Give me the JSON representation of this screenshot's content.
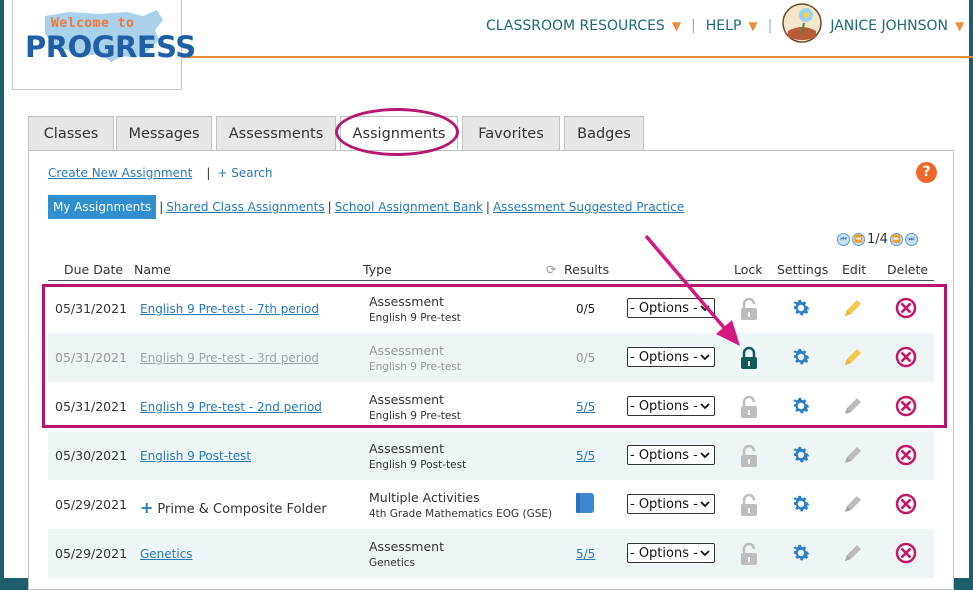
{
  "brand": {
    "logo_top": "Welcome to",
    "logo_main": "PROGRESS",
    "accent": "#f08a3c",
    "primary": "#1f6a76",
    "highlight": "#b5176f"
  },
  "topnav": {
    "resources": "CLASSROOM RESOURCES",
    "help": "HELP",
    "user": "JANICE JOHNSON"
  },
  "tabs": [
    "Classes",
    "Messages",
    "Assessments",
    "Assignments",
    "Favorites",
    "Badges"
  ],
  "active_tab": "Assignments",
  "actions": {
    "create": "Create New Assignment",
    "search": "+ Search"
  },
  "filters": [
    "My Assignments",
    "Shared Class Assignments",
    "School Assignment Bank",
    "Assessment Suggested Practice"
  ],
  "pager": {
    "page": "1/4"
  },
  "columns": {
    "due": "Due Date",
    "name": "Name",
    "type": "Type",
    "results": "Results",
    "lock": "Lock",
    "settings": "Settings",
    "edit": "Edit",
    "delete": "Delete"
  },
  "options_label": "- Options -",
  "rows": [
    {
      "due": "05/31/2021",
      "name": "English 9 Pre-test - 7th period",
      "type": "Assessment",
      "subtype": "English 9 Pre-test",
      "results": "0/5",
      "results_link": false,
      "locked": false,
      "edit": "yellow",
      "dim": false
    },
    {
      "due": "05/31/2021",
      "name": "English 9 Pre-test - 3rd period",
      "type": "Assessment",
      "subtype": "English 9 Pre-test",
      "results": "0/5",
      "results_link": false,
      "locked": true,
      "edit": "yellow",
      "dim": true
    },
    {
      "due": "05/31/2021",
      "name": "English 9 Pre-test - 2nd period",
      "type": "Assessment",
      "subtype": "English 9 Pre-test",
      "results": "5/5",
      "results_link": true,
      "locked": false,
      "edit": "gray",
      "dim": false
    },
    {
      "due": "05/30/2021",
      "name": "English 9 Post-test",
      "type": "Assessment",
      "subtype": "English 9 Post-test",
      "results": "5/5",
      "results_link": true,
      "locked": false,
      "edit": "gray",
      "dim": false
    },
    {
      "due": "05/29/2021",
      "name": "Prime & Composite Folder",
      "folder": true,
      "type": "Multiple Activities",
      "subtype": "4th Grade Mathematics EOG (GSE)",
      "results": "",
      "results_link": false,
      "locked": false,
      "edit": "gray",
      "dim": false
    },
    {
      "due": "05/29/2021",
      "name": "Genetics",
      "type": "Assessment",
      "subtype": "Genetics",
      "results": "5/5",
      "results_link": true,
      "locked": false,
      "edit": "gray",
      "dim": false
    }
  ]
}
